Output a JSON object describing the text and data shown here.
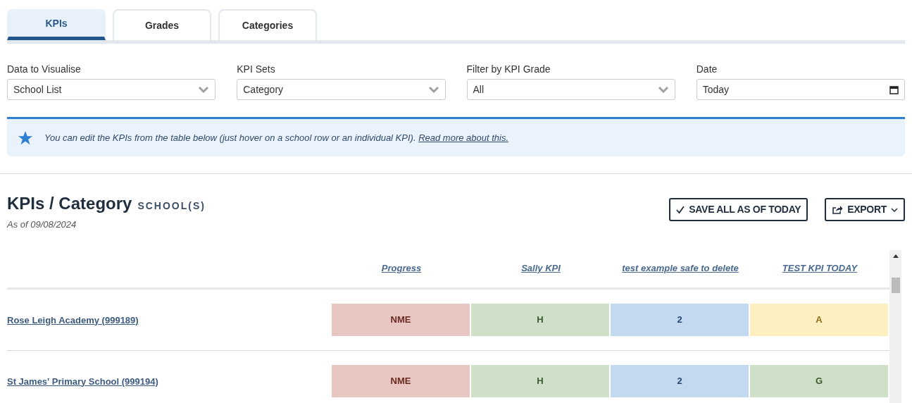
{
  "tabs": [
    {
      "label": "KPIs",
      "selected": true
    },
    {
      "label": "Grades",
      "selected": false
    },
    {
      "label": "Categories",
      "selected": false
    }
  ],
  "filters": [
    {
      "label": "Data to Visualise",
      "value": "School List",
      "kind": "select"
    },
    {
      "label": "KPI Sets",
      "value": "Category",
      "kind": "select"
    },
    {
      "label": "Filter by KPI Grade",
      "value": "All",
      "kind": "select"
    },
    {
      "label": "Date",
      "value": "Today",
      "kind": "date"
    }
  ],
  "banner": {
    "text": "*You can edit the KPIs from the table below (just hover on a school row or an individual KPI).*",
    "link": "Read more about this."
  },
  "heading": {
    "title": "KPIs / Category",
    "subtitle": "SCHOOL(S)",
    "as_of": "As of 09/08/2024"
  },
  "buttons": [
    {
      "label": "SAVE ALL AS OF TODAY",
      "kind": "save"
    },
    {
      "label": "EXPORT",
      "kind": "export"
    }
  ],
  "table": {
    "columns": [
      "Progress",
      "Sally KPI",
      "test example safe to delete",
      "TEST KPI TODAY"
    ],
    "rows": [
      {
        "school": "Rose Leigh Academy (999189)",
        "cells": [
          {
            "value": "NME",
            "color": "#e8c6c2"
          },
          {
            "value": "H",
            "color": "#cee1c8"
          },
          {
            "value": "2",
            "color": "#c3d9f0"
          },
          {
            "value": "A",
            "color": "#fdefc0"
          }
        ]
      },
      {
        "school": "St James' Primary School (999194)",
        "cells": [
          {
            "value": "NME",
            "color": "#e8c6c2"
          },
          {
            "value": "H",
            "color": "#cee1c8"
          },
          {
            "value": "2",
            "color": "#c3d9f0"
          },
          {
            "value": "G",
            "color": "#cee1c8"
          }
        ]
      }
    ]
  }
}
